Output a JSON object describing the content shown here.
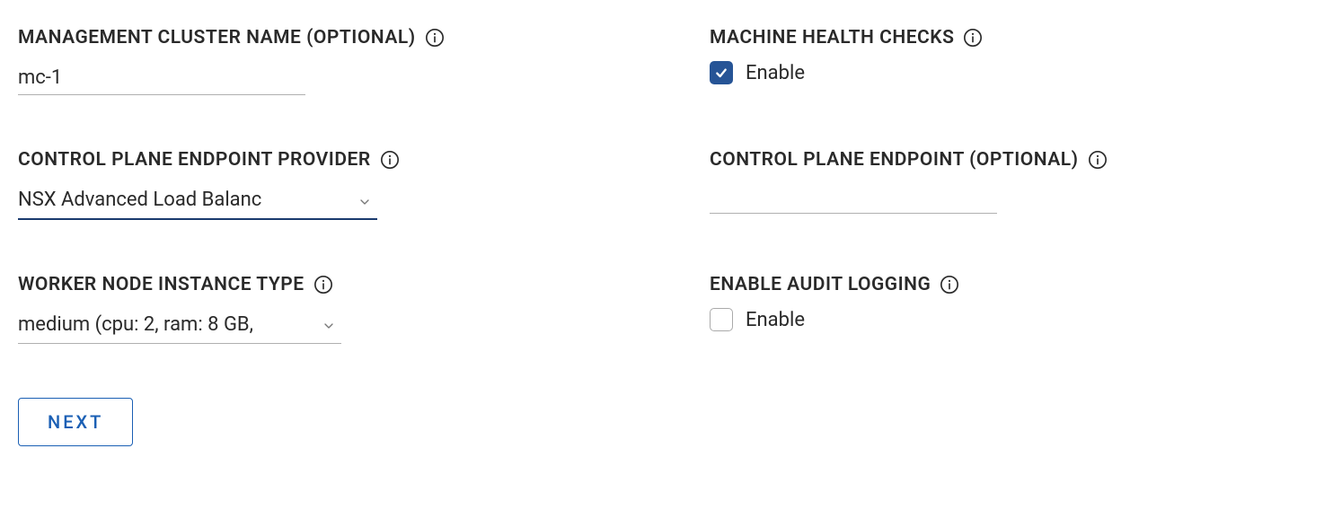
{
  "fields": {
    "management_cluster_name": {
      "label": "MANAGEMENT CLUSTER NAME (OPTIONAL)",
      "value": "mc-1"
    },
    "machine_health_checks": {
      "label": "MACHINE HEALTH CHECKS",
      "checkbox_label": "Enable",
      "checked": true
    },
    "control_plane_endpoint_provider": {
      "label": "CONTROL PLANE ENDPOINT PROVIDER",
      "value": "NSX Advanced Load Balanc"
    },
    "control_plane_endpoint": {
      "label": "CONTROL PLANE ENDPOINT (OPTIONAL)",
      "value": ""
    },
    "worker_node_instance_type": {
      "label": "WORKER NODE INSTANCE TYPE",
      "value": "medium (cpu: 2, ram: 8 GB,"
    },
    "enable_audit_logging": {
      "label": "ENABLE AUDIT LOGGING",
      "checkbox_label": "Enable",
      "checked": false
    }
  },
  "buttons": {
    "next": "NEXT"
  }
}
